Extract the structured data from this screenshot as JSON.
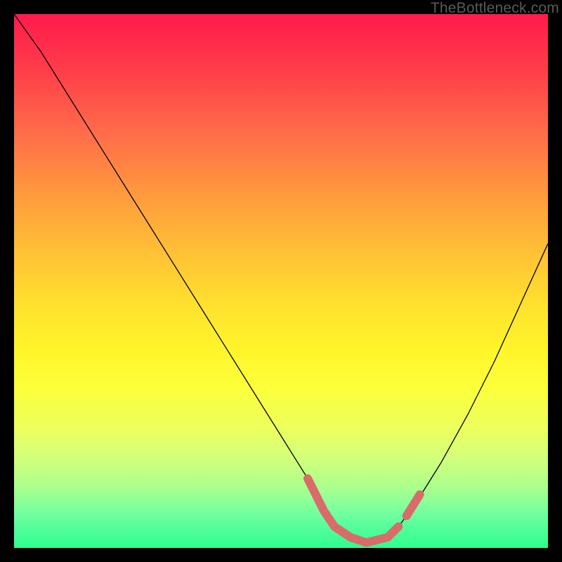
{
  "watermark": "TheBottleneck.com",
  "chart_data": {
    "type": "line",
    "title": "",
    "xlabel": "",
    "ylabel": "",
    "xlim": [
      0,
      100
    ],
    "ylim": [
      0,
      100
    ],
    "series": [
      {
        "name": "bottleneck-curve",
        "x": [
          0,
          5,
          10,
          15,
          20,
          25,
          30,
          35,
          40,
          45,
          50,
          55,
          58,
          60,
          63,
          66,
          70,
          72,
          75,
          80,
          85,
          90,
          95,
          100
        ],
        "y": [
          100,
          93,
          85,
          77,
          69,
          61,
          53,
          45,
          37,
          29,
          21,
          13,
          7,
          4,
          2,
          1,
          2,
          4,
          8,
          16,
          25,
          35,
          46,
          57
        ]
      }
    ],
    "highlight_segments": [
      {
        "name": "main-valley",
        "x": [
          55,
          58,
          60,
          63,
          66,
          70,
          72
        ],
        "y": [
          13,
          7,
          4,
          2,
          1,
          2,
          4
        ]
      },
      {
        "name": "right-bump",
        "x": [
          73.5,
          76
        ],
        "y": [
          6,
          10
        ]
      }
    ],
    "background_gradient": {
      "top": "#ff1a4d",
      "mid": "#ffe22e",
      "bottom": "#2cfd90"
    }
  }
}
